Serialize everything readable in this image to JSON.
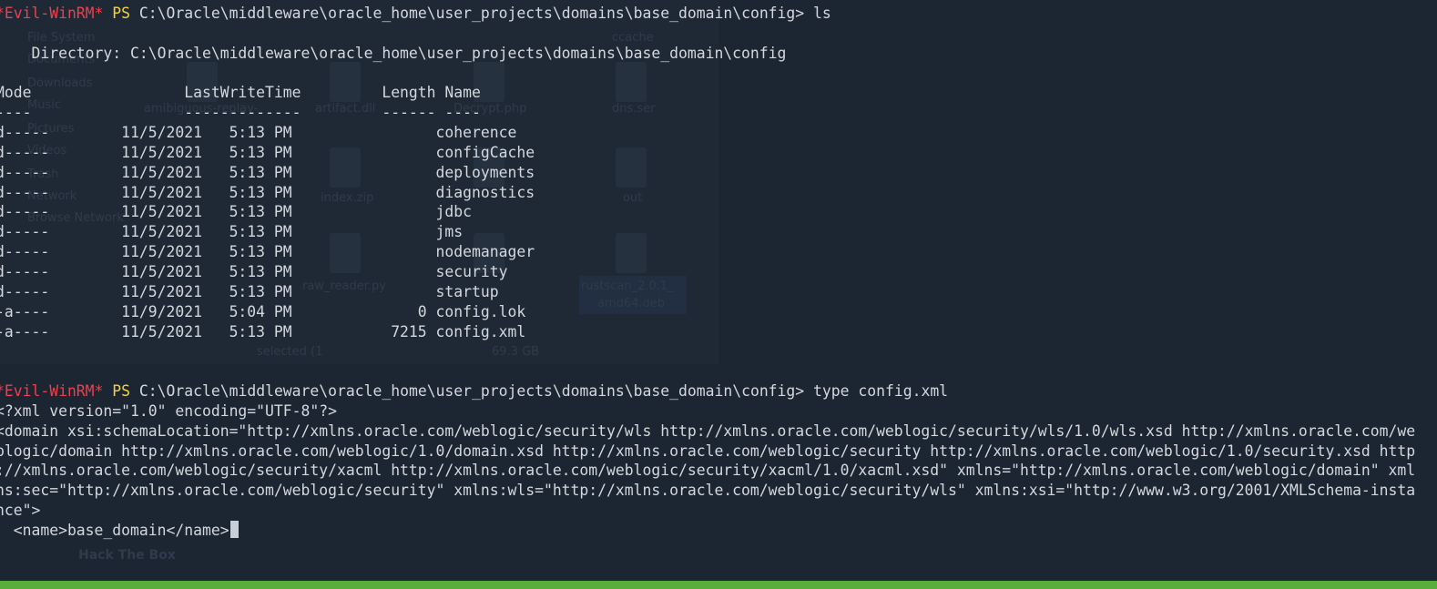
{
  "terminal": {
    "prompt": {
      "evil": "*Evil-WinRM*",
      "ps": "PS",
      "path": "C:\\Oracle\\middleware\\oracle_home\\user_projects\\domains\\base_domain\\config>"
    },
    "cmd1": "ls",
    "directory_line": "    Directory: C:\\Oracle\\middleware\\oracle_home\\user_projects\\domains\\base_domain\\config",
    "header_line": "Mode                 LastWriteTime         Length Name",
    "separator_line": "----                 -------------         ------ ----",
    "rows": [
      "d-----        11/5/2021   5:13 PM                coherence",
      "d-----        11/5/2021   5:13 PM                configCache",
      "d-----        11/5/2021   5:13 PM                deployments",
      "d-----        11/5/2021   5:13 PM                diagnostics",
      "d-----        11/5/2021   5:13 PM                jdbc",
      "d-----        11/5/2021   5:13 PM                jms",
      "d-----        11/5/2021   5:13 PM                nodemanager",
      "d-----        11/5/2021   5:13 PM                security",
      "d-----        11/5/2021   5:13 PM                startup",
      "-a----        11/9/2021   5:04 PM              0 config.lok",
      "-a----        11/5/2021   5:13 PM           7215 config.xml"
    ],
    "cmd2": "type config.xml",
    "xml_lines": [
      "<?xml version=\"1.0\" encoding=\"UTF-8\"?>",
      "<domain xsi:schemaLocation=\"http://xmlns.oracle.com/weblogic/security/wls http://xmlns.oracle.com/weblogic/security/wls/1.0/wls.xsd http://xmlns.oracle.com/weblogic/domain http://xmlns.oracle.com/weblogic/1.0/domain.xsd http://xmlns.oracle.com/weblogic/security http://xmlns.oracle.com/weblogic/1.0/security.xsd http://xmlns.oracle.com/weblogic/security/xacml http://xmlns.oracle.com/weblogic/security/xacml/1.0/xacml.xsd\" xmlns=\"http://xmlns.oracle.com/weblogic/domain\" xmlns:sec=\"http://xmlns.oracle.com/weblogic/security\" xmlns:wls=\"http://xmlns.oracle.com/weblogic/security/wls\" xmlns:xsi=\"http://www.w3.org/2001/XMLSchema-instance\">",
      "  <name>base_domain</name>"
    ]
  },
  "terminal_wrapped": {
    "xml_domain_wrap": [
      "<domain xsi:schemaLocation=\"http://xmlns.oracle.com/weblogic/security/wls http://xmlns.oracle.com/weblogic/security/wls/1.0/wls.xsd http://xmlns.oracle.com/we",
      "blogic/domain http://xmlns.oracle.com/weblogic/1.0/domain.xsd http://xmlns.oracle.com/weblogic/security http://xmlns.oracle.com/weblogic/1.0/security.xsd http",
      "://xmlns.oracle.com/weblogic/security/xacml http://xmlns.oracle.com/weblogic/security/xacml/1.0/xacml.xsd\" xmlns=\"http://xmlns.oracle.com/weblogic/domain\" xml",
      "ns:sec=\"http://xmlns.oracle.com/weblogic/security\" xmlns:wls=\"http://xmlns.oracle.com/weblogic/security/wls\" xmlns:xsi=\"http://www.w3.org/2001/XMLSchema-insta",
      "nce\">"
    ]
  },
  "background": {
    "sidebar": [
      "File System",
      "Documents",
      "Downloads",
      "Music",
      "Pictures",
      "Videos",
      "Trash",
      "Network",
      "Browse Network"
    ],
    "files": [
      "ccache",
      "amibiguous-replay-",
      "artifact.dll",
      "Decrypt.php",
      "dns.ser",
      "index.zip",
      "out",
      "raw_reader.py",
      "rustscan_2.0.1_",
      "amd64.deb"
    ],
    "status": "selected (1",
    "free_space": "69.3 GB",
    "watermark": "Hack The Box"
  },
  "colors": {
    "background": "#1c2532",
    "text": "#d4d8dd",
    "evil": "#e8424e",
    "ps": "#f5d23b",
    "statusbar": "#58ad3d"
  }
}
